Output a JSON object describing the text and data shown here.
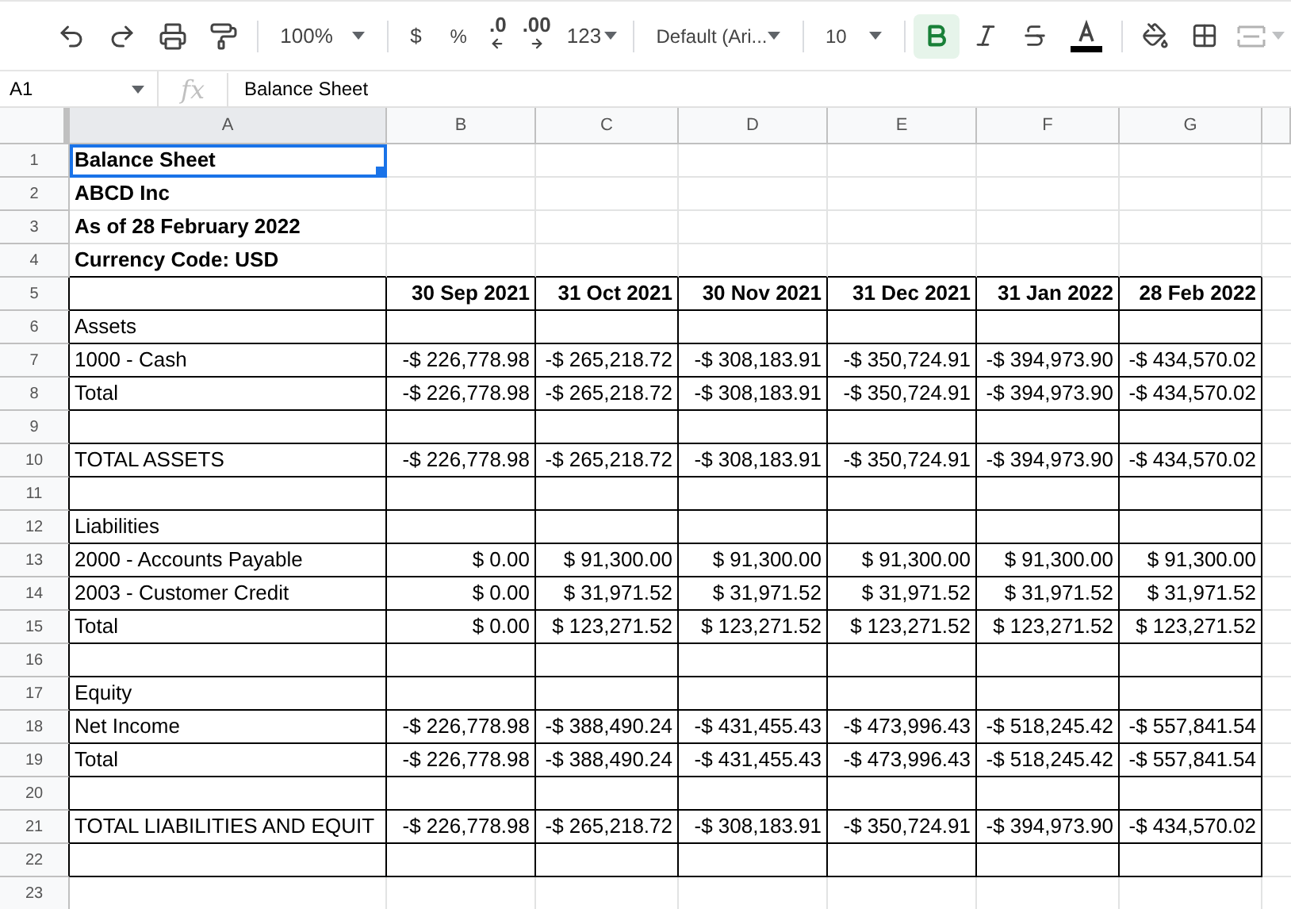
{
  "toolbar": {
    "zoom": "100%",
    "currency": "$",
    "percent": "%",
    "decrease_decimals": ".0",
    "increase_decimals": ".00",
    "number_format": "123",
    "font": "Default (Ari...",
    "font_size": "10",
    "bold": true,
    "merge_disabled": true
  },
  "formula_bar": {
    "cell_ref": "A1",
    "fx": "fx",
    "value": "Balance Sheet"
  },
  "columns": [
    "A",
    "B",
    "C",
    "D",
    "E",
    "F",
    "G"
  ],
  "rows": [
    {
      "number": "1",
      "label": "Balance Sheet",
      "bold": true,
      "bordered": false,
      "selected": true
    },
    {
      "number": "2",
      "label": "ABCD Inc",
      "bold": true,
      "bordered": false,
      "selected": false
    },
    {
      "number": "3",
      "label": "As of 28 February 2022",
      "bold": true,
      "bordered": false,
      "selected": false
    },
    {
      "number": "4",
      "label": "Currency Code: USD",
      "bold": true,
      "bordered": false,
      "selected": false
    },
    {
      "number": "5",
      "values": [
        "30 Sep 2021",
        "31 Oct 2021",
        "30 Nov 2021",
        "31 Dec 2021",
        "31 Jan 2022",
        "28 Feb 2022"
      ],
      "bold": true,
      "bordered": true,
      "selected": false
    },
    {
      "number": "6",
      "label": "Assets",
      "bold": false,
      "bordered": true,
      "selected": false
    },
    {
      "number": "7",
      "label": "1000 - Cash",
      "values": [
        "-$ 226,778.98",
        "-$ 265,218.72",
        "-$ 308,183.91",
        "-$ 350,724.91",
        "-$ 394,973.90",
        "-$ 434,570.02"
      ],
      "bold": false,
      "bordered": true,
      "selected": false
    },
    {
      "number": "8",
      "label": "Total",
      "values": [
        "-$ 226,778.98",
        "-$ 265,218.72",
        "-$ 308,183.91",
        "-$ 350,724.91",
        "-$ 394,973.90",
        "-$ 434,570.02"
      ],
      "bold": false,
      "bordered": true,
      "selected": false
    },
    {
      "number": "9",
      "bordered": true,
      "selected": false
    },
    {
      "number": "10",
      "label": "TOTAL ASSETS",
      "values": [
        "-$ 226,778.98",
        "-$ 265,218.72",
        "-$ 308,183.91",
        "-$ 350,724.91",
        "-$ 394,973.90",
        "-$ 434,570.02"
      ],
      "bold": false,
      "bordered": true,
      "selected": false
    },
    {
      "number": "11",
      "bordered": true,
      "selected": false
    },
    {
      "number": "12",
      "label": "Liabilities",
      "bold": false,
      "bordered": true,
      "selected": false
    },
    {
      "number": "13",
      "label": "2000 - Accounts Payable",
      "values": [
        "$ 0.00",
        "$ 91,300.00",
        "$ 91,300.00",
        "$ 91,300.00",
        "$ 91,300.00",
        "$ 91,300.00"
      ],
      "bold": false,
      "bordered": true,
      "selected": false
    },
    {
      "number": "14",
      "label": "2003 - Customer Credit",
      "values": [
        "$ 0.00",
        "$ 31,971.52",
        "$ 31,971.52",
        "$ 31,971.52",
        "$ 31,971.52",
        "$ 31,971.52"
      ],
      "bold": false,
      "bordered": true,
      "selected": false
    },
    {
      "number": "15",
      "label": "Total",
      "values": [
        "$ 0.00",
        "$ 123,271.52",
        "$ 123,271.52",
        "$ 123,271.52",
        "$ 123,271.52",
        "$ 123,271.52"
      ],
      "bold": false,
      "bordered": true,
      "selected": false
    },
    {
      "number": "16",
      "bordered": true,
      "selected": false
    },
    {
      "number": "17",
      "label": "Equity",
      "bold": false,
      "bordered": true,
      "selected": false
    },
    {
      "number": "18",
      "label": "Net Income",
      "values": [
        "-$ 226,778.98",
        "-$ 388,490.24",
        "-$ 431,455.43",
        "-$ 473,996.43",
        "-$ 518,245.42",
        "-$ 557,841.54"
      ],
      "bold": false,
      "bordered": true,
      "selected": false
    },
    {
      "number": "19",
      "label": "Total",
      "values": [
        "-$ 226,778.98",
        "-$ 388,490.24",
        "-$ 431,455.43",
        "-$ 473,996.43",
        "-$ 518,245.42",
        "-$ 557,841.54"
      ],
      "bold": false,
      "bordered": true,
      "selected": false
    },
    {
      "number": "20",
      "bordered": true,
      "selected": false
    },
    {
      "number": "21",
      "label": "TOTAL LIABILITIES AND EQUIT",
      "values": [
        "-$ 226,778.98",
        "-$ 265,218.72",
        "-$ 308,183.91",
        "-$ 350,724.91",
        "-$ 394,973.90",
        "-$ 434,570.02"
      ],
      "bold": false,
      "bordered": true,
      "selected": false
    },
    {
      "number": "22",
      "bordered": true,
      "selected": false
    },
    {
      "number": "23",
      "bordered": false,
      "selected": false
    }
  ]
}
